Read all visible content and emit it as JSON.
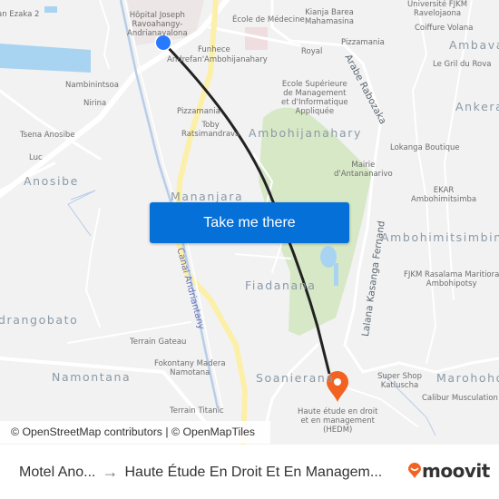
{
  "map": {
    "labels": [
      {
        "text": "Hôpital Joseph\nRavoahangy-\nAndrianavalona"
      },
      {
        "text": "an Ezaka 2"
      },
      {
        "text": "Funhece"
      },
      {
        "text": "Andrefan'Ambohijanahary"
      },
      {
        "text": "Nambinintsoa"
      },
      {
        "text": "Nirina"
      },
      {
        "text": "Pizzamania"
      },
      {
        "text": "Toby\nRatsimandrava"
      },
      {
        "text": "Tsena Anosibe"
      },
      {
        "text": "Luc"
      },
      {
        "text": "École de Médecine"
      },
      {
        "text": "Kianja Barea\nMahamasina"
      },
      {
        "text": "Université FJKM\nRavelojaona"
      },
      {
        "text": "Coiffure Volana"
      },
      {
        "text": "Pizzamania"
      },
      {
        "text": "Royal"
      },
      {
        "text": "Le Gril du Rova"
      },
      {
        "text": "Ecole Supérieure\nde Management\net d'Informatique\nAppliquée"
      },
      {
        "text": "Lokanga Boutique"
      },
      {
        "text": "Mairie\nd'Antananarivo"
      },
      {
        "text": "EKAR\nAmbohimitsimba"
      },
      {
        "text": "FJKM Rasalama Maritiora\nAmbohipotsy"
      },
      {
        "text": "Terrain Gateau"
      },
      {
        "text": "Fokontany Madera\nNamotana"
      },
      {
        "text": "Terrain Titanic"
      },
      {
        "text": "Super Shop\nKatluscha"
      },
      {
        "text": "Calibur Musculation"
      },
      {
        "text": "Haute étude en droit\net en management\n(HEDM)"
      }
    ],
    "districts": [
      {
        "text": "Ambaval"
      },
      {
        "text": "Ankeral"
      },
      {
        "text": "Ambohijanahary"
      },
      {
        "text": "Anosibe"
      },
      {
        "text": "Mananjara"
      },
      {
        "text": "Ambohimitsimbina"
      },
      {
        "text": "Fiadanana"
      },
      {
        "text": "drangobato"
      },
      {
        "text": "Namontana"
      },
      {
        "text": "Soanierana"
      },
      {
        "text": "Marohoho"
      }
    ],
    "streets": [
      {
        "text": "Arabe Rabozaka"
      },
      {
        "text": "Lalana Kasanga Fernand"
      }
    ],
    "canals": [
      {
        "text": "Canal Andriantany"
      }
    ],
    "origin_marker": {
      "color": "#2979ff",
      "icon": "current-location-dot"
    },
    "destination_marker": {
      "color": "#f26322",
      "icon": "map-pin"
    },
    "route_color": "#222222",
    "cta_button": {
      "label": "Take me there",
      "color": "#0570d8"
    },
    "attribution": "© OpenStreetMap contributors | © OpenMapTiles"
  },
  "footer": {
    "origin": "Motel Ano...",
    "arrow": "→",
    "destination": "Haute Étude En Droit Et En Managem...",
    "brand": {
      "name": "moovit",
      "color": "#f26322"
    }
  }
}
